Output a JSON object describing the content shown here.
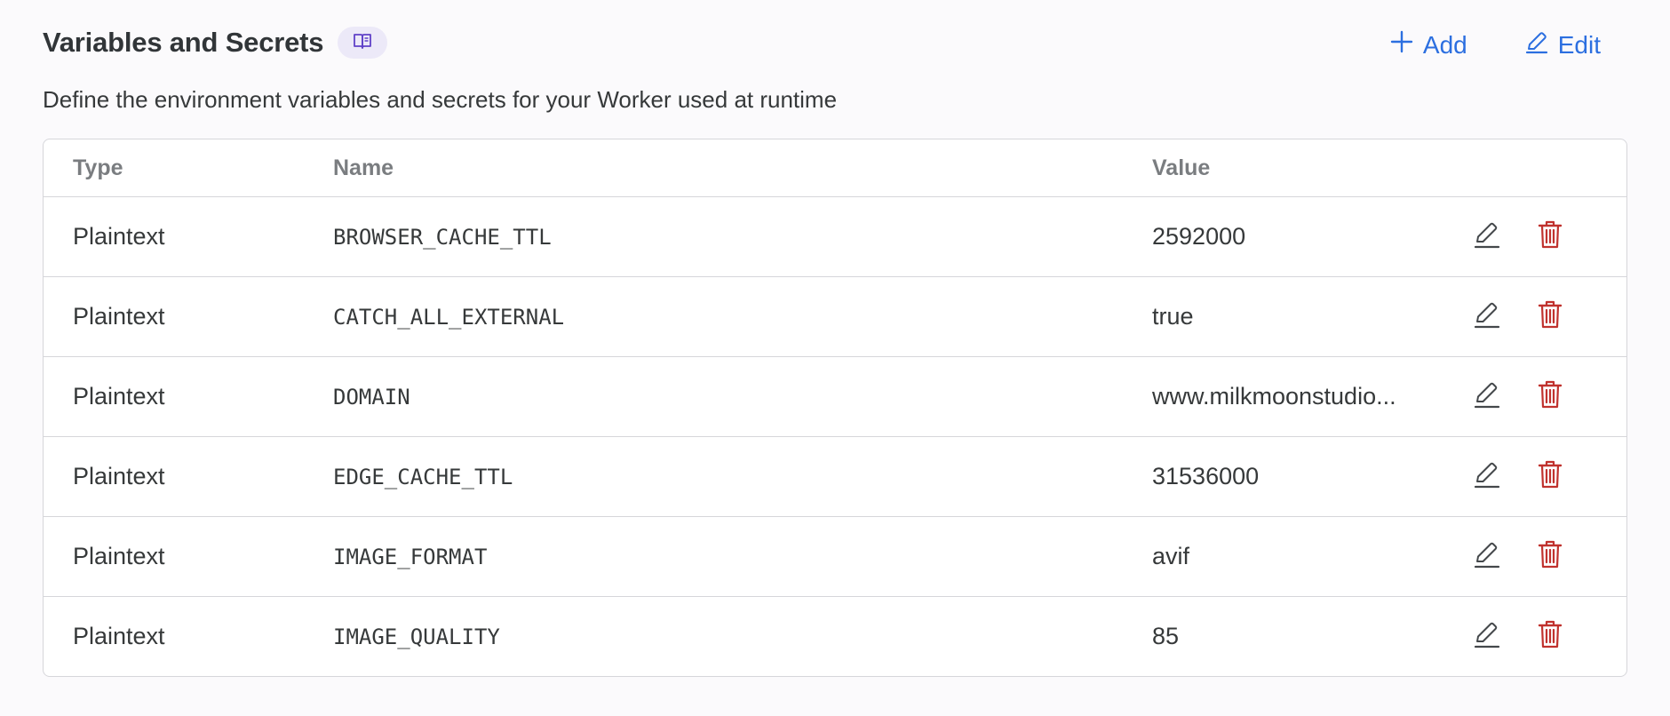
{
  "section": {
    "title": "Variables and Secrets",
    "description": "Define the environment variables and secrets for your Worker used at runtime",
    "add_label": "Add",
    "edit_label": "Edit"
  },
  "colors": {
    "accent": "#2c6fe0",
    "delete": "#c0322e",
    "badge_bg": "#ece9f8",
    "badge_icon": "#6042c8"
  },
  "table": {
    "headers": {
      "type": "Type",
      "name": "Name",
      "value": "Value"
    },
    "rows": [
      {
        "type": "Plaintext",
        "name": "BROWSER_CACHE_TTL",
        "value": "2592000"
      },
      {
        "type": "Plaintext",
        "name": "CATCH_ALL_EXTERNAL",
        "value": "true"
      },
      {
        "type": "Plaintext",
        "name": "DOMAIN",
        "value": "www.milkmoonstudio..."
      },
      {
        "type": "Plaintext",
        "name": "EDGE_CACHE_TTL",
        "value": "31536000"
      },
      {
        "type": "Plaintext",
        "name": "IMAGE_FORMAT",
        "value": "avif"
      },
      {
        "type": "Plaintext",
        "name": "IMAGE_QUALITY",
        "value": "85"
      }
    ]
  },
  "icons": {
    "docs": "book-icon",
    "add": "plus-icon",
    "edit": "pencil-icon",
    "delete": "trash-icon"
  }
}
